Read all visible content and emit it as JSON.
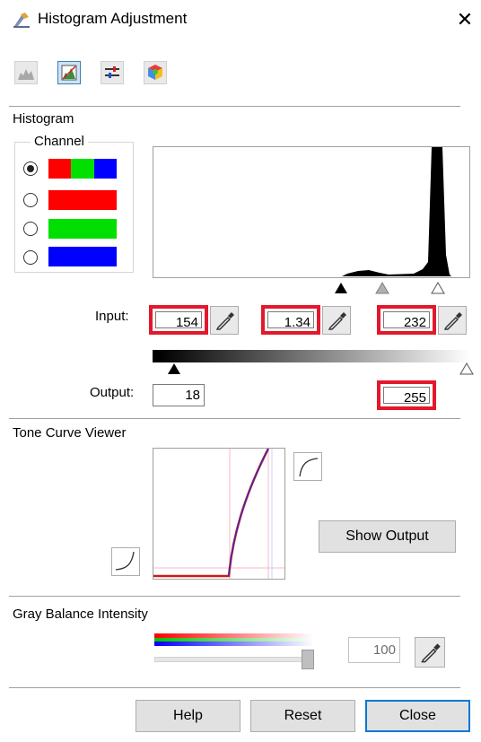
{
  "window": {
    "title": "Histogram Adjustment",
    "close_glyph": "✕"
  },
  "toolbar": [
    {
      "icon": "histogram-icon",
      "active": false
    },
    {
      "icon": "histogram-adjust-icon",
      "active": true
    },
    {
      "icon": "sliders-icon",
      "active": false
    },
    {
      "icon": "color-cube-icon",
      "active": false
    }
  ],
  "histogram": {
    "section_label": "Histogram",
    "channel_label": "Channel",
    "channels": [
      {
        "name": "rgb",
        "colors": [
          "#ff0000",
          "#00e000",
          "#0000ff"
        ],
        "selected": true
      },
      {
        "name": "red",
        "colors": [
          "#ff0000"
        ],
        "selected": false
      },
      {
        "name": "green",
        "colors": [
          "#00e000"
        ],
        "selected": false
      },
      {
        "name": "blue",
        "colors": [
          "#0000ff"
        ],
        "selected": false
      }
    ]
  },
  "input": {
    "label": "Input:",
    "shadow": "154",
    "midtone": "1.34",
    "highlight": "232"
  },
  "output": {
    "label": "Output:",
    "shadow": "18",
    "highlight": "255"
  },
  "tone_curve": {
    "section_label": "Tone Curve Viewer",
    "show_output_label": "Show Output"
  },
  "gray_balance": {
    "section_label": "Gray Balance Intensity",
    "value": "100"
  },
  "buttons": {
    "help": "Help",
    "reset": "Reset",
    "close": "Close"
  },
  "colors": {
    "highlight_border": "#e3182c",
    "accent": "#0078d7"
  }
}
